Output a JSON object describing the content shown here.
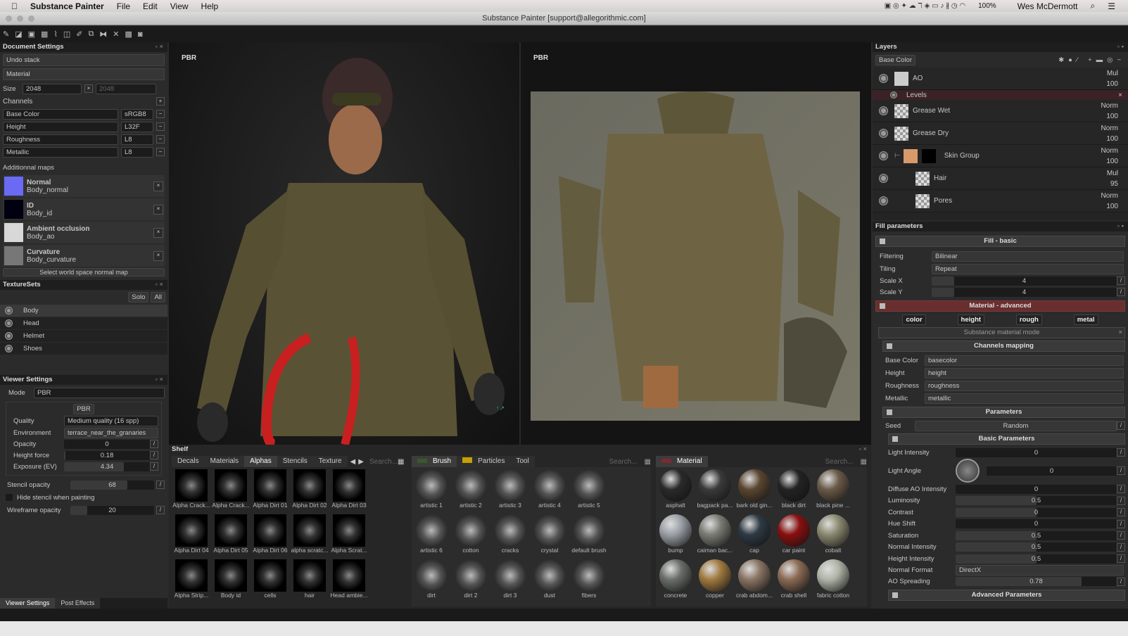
{
  "menubar": {
    "app": "Substance Painter",
    "items": [
      "File",
      "Edit",
      "View",
      "Help"
    ],
    "battery": "100%",
    "user": "Wes McDermott"
  },
  "window": {
    "title": "Substance Painter [support@allegorithmic.com]"
  },
  "document_settings": {
    "title": "Document Settings",
    "undo_stack": "Undo stack",
    "material": "Material",
    "size_label": "Size",
    "size_w": "2048",
    "size_h": "2048",
    "channels_label": "Channels",
    "channels": [
      {
        "name": "Base Color",
        "format": "sRGB8"
      },
      {
        "name": "Height",
        "format": "L32F"
      },
      {
        "name": "Roughness",
        "format": "L8"
      },
      {
        "name": "Metallic",
        "format": "L8"
      }
    ],
    "additional_maps_label": "Additionnal maps",
    "maps": [
      {
        "name": "Normal",
        "file": "Body_normal",
        "color": "#6a6af5"
      },
      {
        "name": "ID",
        "file": "Body_id",
        "color": "#000010"
      },
      {
        "name": "Ambient occlusion",
        "file": "Body_ao",
        "color": "#d8d8d8"
      },
      {
        "name": "Curvature",
        "file": "Body_curvature",
        "color": "#777777"
      }
    ],
    "select_normal": "Select world space normal map"
  },
  "texture_sets": {
    "title": "TextureSets",
    "solo": "Solo",
    "all": "All",
    "items": [
      "Body",
      "Head",
      "Helmet",
      "Shoes"
    ]
  },
  "viewer_settings": {
    "title": "Viewer Settings",
    "mode_label": "Mode",
    "mode": "PBR",
    "pbr_tab": "PBR",
    "quality_label": "Quality",
    "quality": "Medium quality (16 spp)",
    "environment_label": "Environment",
    "environment": "terrace_near_the_granaries",
    "sliders": [
      {
        "label": "Opacity",
        "value": "0",
        "fraction": 0
      },
      {
        "label": "Height force",
        "value": "0.18",
        "fraction": 0.02
      },
      {
        "label": "Exposure (EV)",
        "value": "4.34",
        "fraction": 0.7
      }
    ],
    "stencil_label": "Stencil opacity",
    "stencil": "68",
    "stencil_fraction": 0.68,
    "hide_stencil": "Hide stencil when painting",
    "wireframe_label": "Wireframe opacity",
    "wireframe": "20",
    "wireframe_fraction": 0.2
  },
  "bottom_tabs": [
    "Viewer Settings",
    "Post Effects"
  ],
  "viewports": {
    "left_label": "PBR",
    "right_label": "PBR"
  },
  "shelf": {
    "title": "Shelf",
    "tabs": [
      "Decals",
      "Materials",
      "Alphas",
      "Stencils",
      "Texture"
    ],
    "active_tab": "Alphas",
    "search": "Search...",
    "alphas": [
      "Alpha Crack...",
      "Alpha Crack...",
      "Alpha Dirt 01",
      "Alpha Dirt 02",
      "Alpha Dirt 03",
      "Alpha Dirt 04",
      "Alpha Dirt 05",
      "Alpha Dirt 06",
      "alpha scratc...",
      "Alpha Scrat...",
      "Alpha Strip...",
      "Body id",
      "cells",
      "hair",
      "Head ambie..."
    ]
  },
  "brush_panel": {
    "tabs": [
      "Brush",
      "Particles",
      "Tool"
    ],
    "search": "Search...",
    "brush_color": "#3a5a2a",
    "particles_color": "#c8a000",
    "items": [
      "artistic 1",
      "artistic 2",
      "artistic 3",
      "artistic 4",
      "artistic 5",
      "artistic 6",
      "cotton",
      "cracks",
      "crystal",
      "default brush",
      "dirt",
      "dirt 2",
      "dirt 3",
      "dust",
      "fibers"
    ]
  },
  "material_panel": {
    "tab": "Material",
    "search": "Search...",
    "swatch": "#7a2a30",
    "items": [
      {
        "name": "asphalt",
        "color": "#2a2a2a"
      },
      {
        "name": "bagpack pa...",
        "color": "#3a3a3a"
      },
      {
        "name": "bark old gin...",
        "color": "#5a4630"
      },
      {
        "name": "black dirt",
        "color": "#232323"
      },
      {
        "name": "black pine ...",
        "color": "#6a5a48"
      },
      {
        "name": "bump",
        "color": "#9aa0a6"
      },
      {
        "name": "caiman bac...",
        "color": "#7a7c74"
      },
      {
        "name": "cap",
        "color": "#2e3a44"
      },
      {
        "name": "car paint",
        "color": "#8a1010"
      },
      {
        "name": "cobalt",
        "color": "#8a8a70"
      },
      {
        "name": "concrete",
        "color": "#6a6e6a"
      },
      {
        "name": "copper",
        "color": "#a07a40"
      },
      {
        "name": "crab abdom...",
        "color": "#8a7464"
      },
      {
        "name": "crab shell",
        "color": "#8a6a54"
      },
      {
        "name": "fabric cotton",
        "color": "#b0b4a8"
      }
    ]
  },
  "layers": {
    "title": "Layers",
    "channel": "Base Color",
    "items": [
      {
        "name": "AO",
        "blend": "Mul",
        "opacity": "100"
      },
      {
        "name": "Grease Wet",
        "blend": "Norm",
        "opacity": "100"
      },
      {
        "name": "Grease Dry",
        "blend": "Norm",
        "opacity": "100"
      },
      {
        "name": "Skin Group",
        "blend": "Norm",
        "opacity": "100"
      },
      {
        "name": "Hair",
        "blend": "Mul",
        "opacity": "95"
      },
      {
        "name": "Pores",
        "blend": "Norm",
        "opacity": "100"
      }
    ],
    "effect": "Levels"
  },
  "fill": {
    "title": "Fill parameters",
    "basic": "Fill - basic",
    "filtering_label": "Filtering",
    "filtering": "Bilinear",
    "tiling_label": "Tiling",
    "tiling": "Repeat",
    "scale_x_label": "Scale X",
    "scale_x": "4",
    "scale_y_label": "Scale Y",
    "scale_y": "4",
    "material_adv": "Material - advanced",
    "channel_buttons": [
      "color",
      "height",
      "rough",
      "metal"
    ],
    "substance_mode": "Substance material mode",
    "channels_mapping": "Channels mapping",
    "mapping": [
      {
        "label": "Base Color",
        "value": "basecolor"
      },
      {
        "label": "Height",
        "value": "height"
      },
      {
        "label": "Roughness",
        "value": "roughness"
      },
      {
        "label": "Metallic",
        "value": "metallic"
      }
    ],
    "parameters": "Parameters",
    "seed_label": "Seed",
    "seed": "Random",
    "basic_params": "Basic Parameters",
    "light_intensity_label": "Light Intensity",
    "light_intensity": "0",
    "light_angle_label": "Light Angle",
    "light_angle": "0",
    "params": [
      {
        "label": "Diffuse AO Intensity",
        "value": "0",
        "fraction": 0
      },
      {
        "label": "Luminosity",
        "value": "0.5",
        "fraction": 0.5
      },
      {
        "label": "Contrast",
        "value": "0",
        "fraction": 0.5
      },
      {
        "label": "Hue Shift",
        "value": "0",
        "fraction": 0
      },
      {
        "label": "Saturation",
        "value": "0.5",
        "fraction": 0.5
      },
      {
        "label": "Normal Intensity",
        "value": "0.5",
        "fraction": 0.5
      },
      {
        "label": "Height Intensity",
        "value": "0.5",
        "fraction": 0.5
      }
    ],
    "normal_format_label": "Normal Format",
    "normal_format": "DirectX",
    "ao_spreading_label": "AO Spreading",
    "ao_spreading": "0.78",
    "ao_fraction": 0.78,
    "advanced": "Advanced Parameters"
  }
}
